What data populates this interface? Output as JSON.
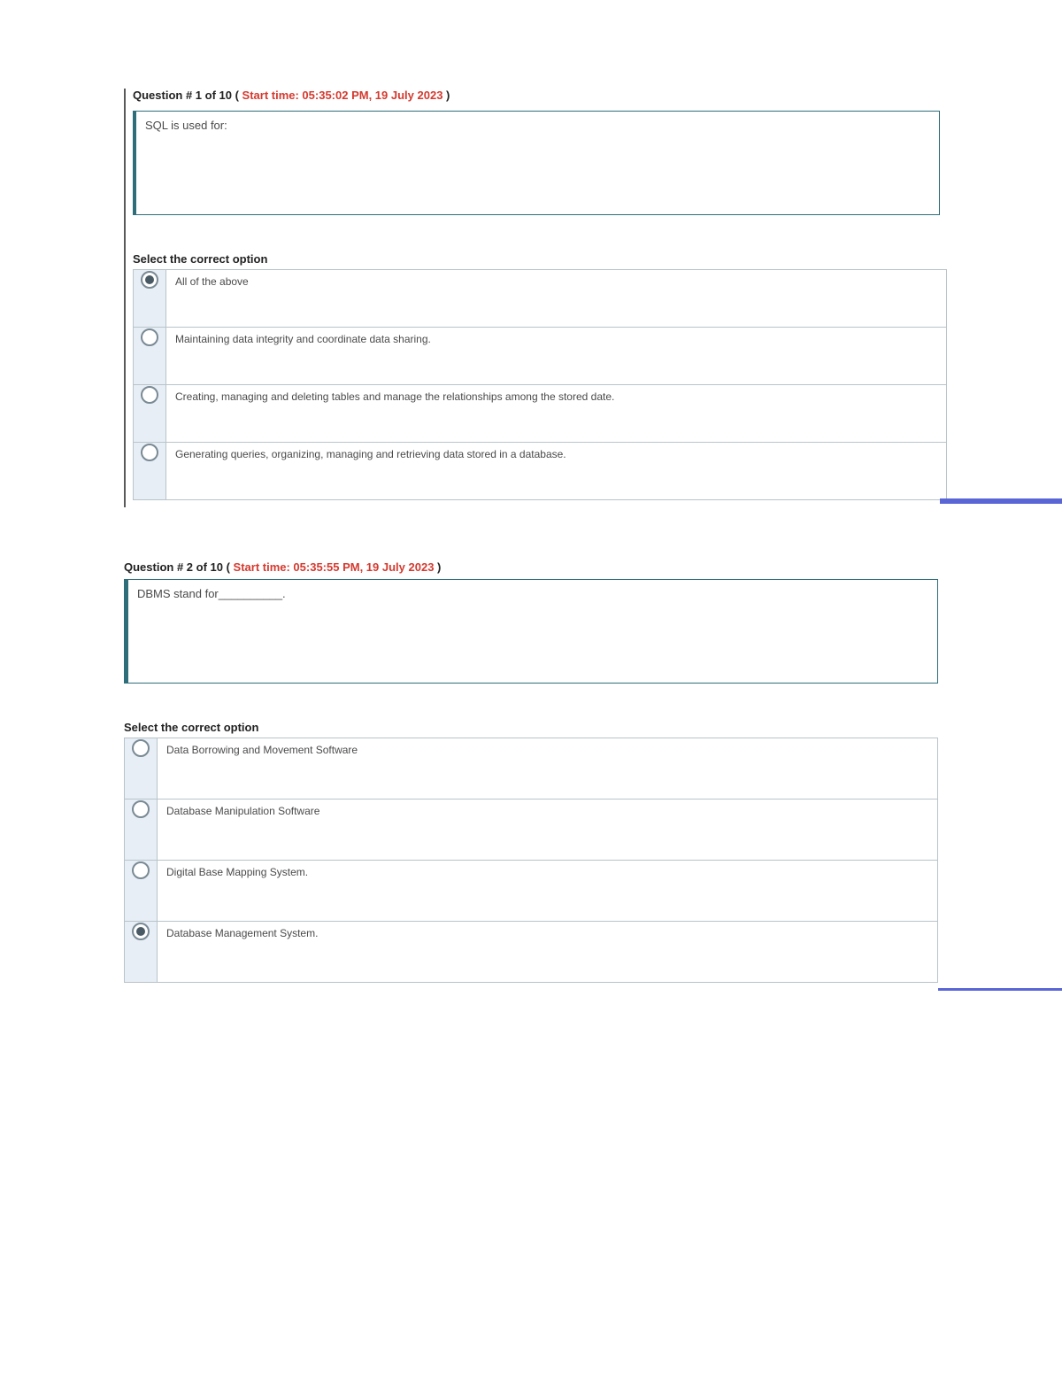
{
  "q1": {
    "header_prefix": "Question # 1 of 10 ( ",
    "header_time": "Start time: 05:35:02 PM, 19 July 2023",
    "header_suffix": " )",
    "stem": "SQL is used for:",
    "select_label": "Select the correct option",
    "options": [
      {
        "text": "All of the above",
        "selected": true
      },
      {
        "text": "Maintaining data integrity and coordinate data sharing.",
        "selected": false
      },
      {
        "text": "Creating, managing and deleting tables and manage the relationships among the stored date.",
        "selected": false
      },
      {
        "text": "Generating queries, organizing, managing and retrieving data stored in a database.",
        "selected": false
      }
    ]
  },
  "q2": {
    "header_prefix": "Question # 2 of 10 ( ",
    "header_time": "Start time: 05:35:55 PM, 19 July 2023",
    "header_suffix": " )",
    "stem": "DBMS stand for__________.",
    "select_label": "Select the correct option",
    "options": [
      {
        "text": "Data Borrowing and Movement Software",
        "selected": false
      },
      {
        "text": "Database Manipulation Software",
        "selected": false
      },
      {
        "text": "Digital Base Mapping System.",
        "selected": false
      },
      {
        "text": "Database Management System.",
        "selected": true
      }
    ]
  }
}
